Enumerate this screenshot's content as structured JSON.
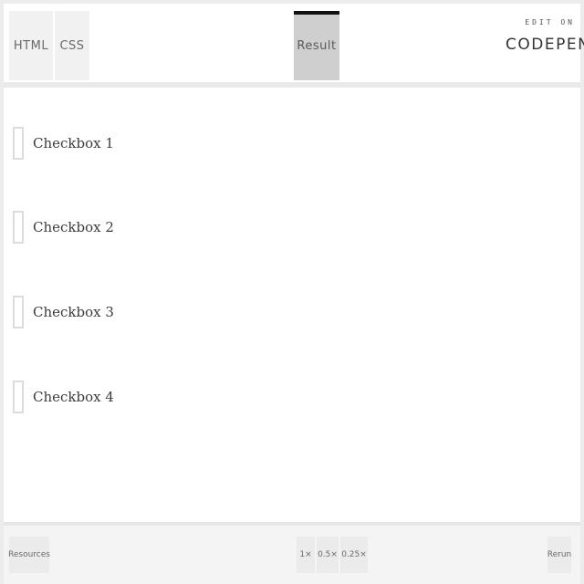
{
  "header": {
    "tabs": [
      {
        "label": "HTML"
      },
      {
        "label": "CSS"
      },
      {
        "label": "Result",
        "active": true
      }
    ],
    "edit_on": "EDIT ON",
    "brand": "CODEPEN"
  },
  "checkboxes": [
    {
      "label": "Checkbox 1",
      "checked": false
    },
    {
      "label": "Checkbox 2",
      "checked": false
    },
    {
      "label": "Checkbox 3",
      "checked": false
    },
    {
      "label": "Checkbox 4",
      "checked": false
    }
  ],
  "footer": {
    "resources": "Resources",
    "zoom": [
      "1×",
      "0.5×",
      "0.25×"
    ],
    "rerun": "Rerun"
  },
  "colors": {
    "active_tab_bg": "#cfcfcf",
    "active_tab_marker": "#111111",
    "tab_bg": "#f1f1f1"
  }
}
